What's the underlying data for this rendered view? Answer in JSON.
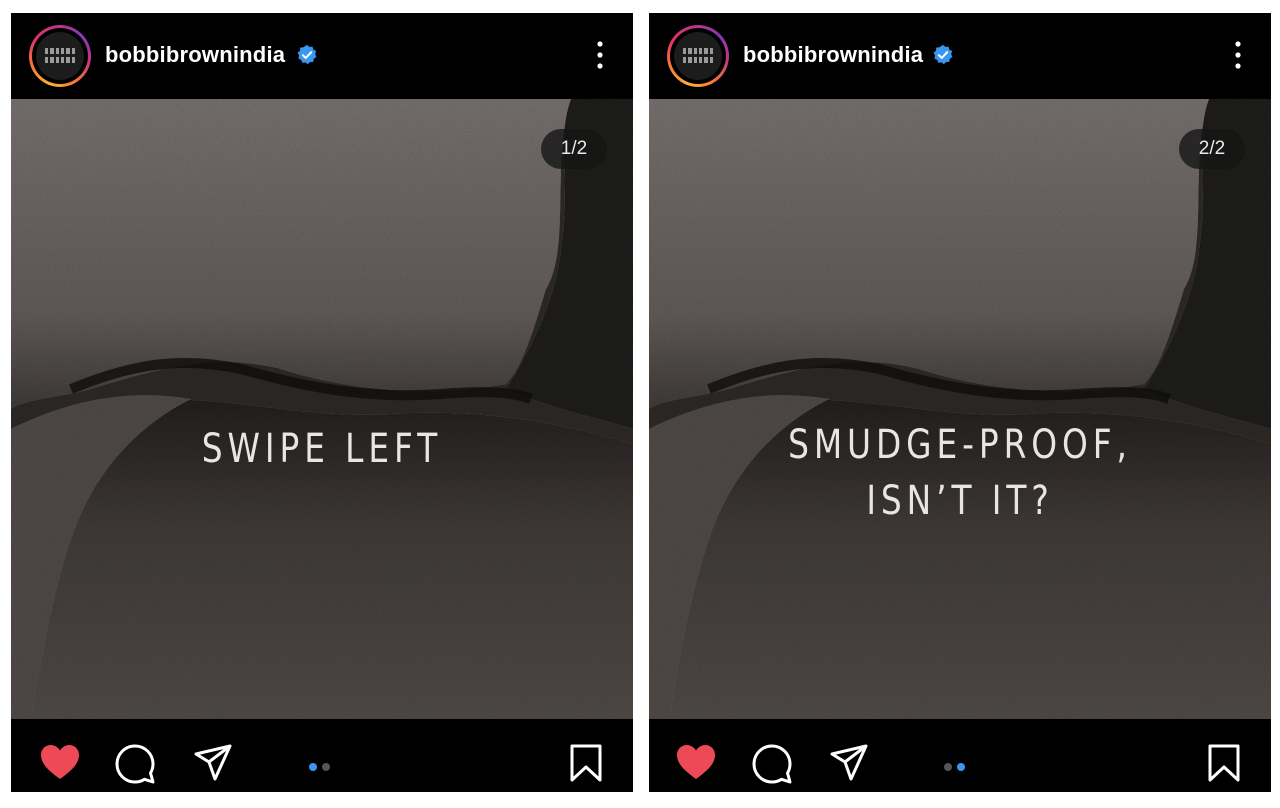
{
  "posts": [
    {
      "username": "bobbibrownindia",
      "verified": true,
      "counter": "1/2",
      "headline": [
        "SWIPE LEFT"
      ],
      "liked": true,
      "carousel": {
        "count": 2,
        "active": 1
      },
      "icons": [
        "avatar-logo",
        "verified-badge-icon",
        "more-options-icon",
        "heart-icon",
        "comment-icon",
        "share-icon",
        "bookmark-icon"
      ]
    },
    {
      "username": "bobbibrownindia",
      "verified": true,
      "counter": "2/2",
      "headline": [
        "SMUDGE-PROOF,",
        "ISN’T IT?"
      ],
      "liked": true,
      "carousel": {
        "count": 2,
        "active": 2
      },
      "icons": [
        "avatar-logo",
        "verified-badge-icon",
        "more-options-icon",
        "heart-icon",
        "comment-icon",
        "share-icon",
        "bookmark-icon"
      ]
    }
  ],
  "colors": {
    "like": "#ed4956",
    "verified": "#3897f0",
    "active_dot": "#3897f0",
    "bar_background": "#000000",
    "text": "#ffffff"
  }
}
